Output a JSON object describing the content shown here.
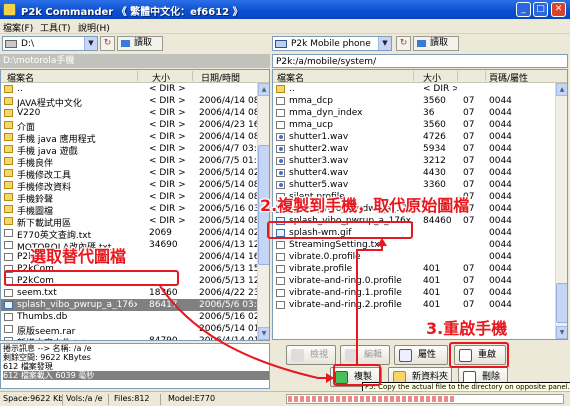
{
  "window": {
    "title": "P2k Commander 《 繁體中文化：ef6612 》",
    "min_label": "_",
    "max_label": "□",
    "close_label": "✕"
  },
  "menu": [
    "檔案(F)",
    "工具(T)",
    "說明(H)"
  ],
  "left_pane": {
    "drive": "D:\\",
    "read_button": "讀取",
    "path": "D:\\motorola手機",
    "columns": [
      "檔案名",
      "大小",
      "日期/時間"
    ],
    "rows": [
      {
        "name": "..",
        "size": "< DIR >",
        "date": "",
        "icon": "folder"
      },
      {
        "name": "JAVA程式中文化",
        "size": "< DIR >",
        "date": "2006/4/14 08:",
        "icon": "folder"
      },
      {
        "name": "V220",
        "size": "< DIR >",
        "date": "2006/4/14 08:",
        "icon": "folder"
      },
      {
        "name": "介面",
        "size": "< DIR >",
        "date": "2006/4/23 16:",
        "icon": "folder"
      },
      {
        "name": "手機 java 應用程式",
        "size": "< DIR >",
        "date": "2006/4/14 08:",
        "icon": "folder"
      },
      {
        "name": "手機 java 遊戲",
        "size": "< DIR >",
        "date": "2006/4/7 03:0",
        "icon": "folder"
      },
      {
        "name": "手機良伴",
        "size": "< DIR >",
        "date": "2006/7/5 01:0",
        "icon": "folder"
      },
      {
        "name": "手機修改工具",
        "size": "< DIR >",
        "date": "2006/5/14 02:",
        "icon": "folder"
      },
      {
        "name": "手機修改資料",
        "size": "< DIR >",
        "date": "2006/5/14 08:",
        "icon": "folder"
      },
      {
        "name": "手機鈴聲",
        "size": "< DIR >",
        "date": "2006/4/14 08:",
        "icon": "folder"
      },
      {
        "name": "手機圖檔",
        "size": "< DIR >",
        "date": "2006/5/16 03:",
        "icon": "folder"
      },
      {
        "name": "新下載試用區",
        "size": "< DIR >",
        "date": "2006/5/14 08:",
        "icon": "folder"
      },
      {
        "name": "E770英文查詢.txt",
        "size": "2069",
        "date": "2006/4/14 02:",
        "icon": "file"
      },
      {
        "name": "MOTOROLA改內碼.txt",
        "size": "34690",
        "date": "2006/4/13 12:",
        "icon": "file"
      },
      {
        "name": "P2k_Ne",
        "size": "",
        "date": "2006/4/14 16:",
        "icon": "file"
      },
      {
        "name": "P2kCom",
        "size": "",
        "date": "2006/5/13 15:",
        "icon": "file"
      },
      {
        "name": "P2kCom",
        "size": "",
        "date": "2006/5/13 12:",
        "icon": "file"
      },
      {
        "name": "seem.txt",
        "size": "18360",
        "date": "2006/4/22 23:",
        "icon": "file"
      },
      {
        "name": "splash_vibo_pwrup_a_176x...",
        "size": "86417",
        "date": "2006/5/6 03:1",
        "icon": "img",
        "selected": true
      },
      {
        "name": "Thumbs.db",
        "size": "",
        "date": "2006/5/16 02:",
        "icon": "file"
      },
      {
        "name": "原版seem.rar",
        "size": "",
        "date": "2006/5/14 01:",
        "icon": "file"
      },
      {
        "name": "新增文字文件.txt",
        "size": "84790",
        "date": "2006/4/14 01:",
        "icon": "file"
      }
    ],
    "info_lines": [
      "捲示訊息 --> 名稱: /a /e",
      "剩餘空間: 9622 KBytes",
      "612 檔案發現",
      "612 檔案載入 6039 毫秒"
    ]
  },
  "right_pane": {
    "drive": "P2k Mobile phone",
    "read_button": "讀取",
    "path": "P2k:/a/mobile/system/",
    "columns": [
      "檔案名",
      "大小",
      "",
      "頁碼/屬性"
    ],
    "rows": [
      {
        "name": "..",
        "size": "< DIR >",
        "c3": "",
        "attr": "",
        "icon": "folder"
      },
      {
        "name": "mma_dcp",
        "size": "3560",
        "c3": "07",
        "attr": "0044",
        "icon": "file"
      },
      {
        "name": "mma_dyn_index",
        "size": "36",
        "c3": "07",
        "attr": "0044",
        "icon": "file"
      },
      {
        "name": "mma_ucp",
        "size": "3560",
        "c3": "07",
        "attr": "0044",
        "icon": "file"
      },
      {
        "name": "shutter1.wav",
        "size": "4726",
        "c3": "07",
        "attr": "0044",
        "icon": "media"
      },
      {
        "name": "shutter2.wav",
        "size": "5934",
        "c3": "07",
        "attr": "0044",
        "icon": "media"
      },
      {
        "name": "shutter3.wav",
        "size": "3212",
        "c3": "07",
        "attr": "0044",
        "icon": "media"
      },
      {
        "name": "shutter4.wav",
        "size": "4430",
        "c3": "07",
        "attr": "0044",
        "icon": "media"
      },
      {
        "name": "shutter5.wav",
        "size": "3360",
        "c3": "07",
        "attr": "0044",
        "icon": "media"
      },
      {
        "name": "silent.profile",
        "size": "",
        "c3": "07",
        "attr": "0044",
        "icon": "file"
      },
      {
        "name": "splash_vibo_pwrdwn_a_176...",
        "size": "",
        "c3": "07",
        "attr": "0044",
        "icon": "img"
      },
      {
        "name": "splash_vibo_pwrup_a_176x...",
        "size": "84460",
        "c3": "07",
        "attr": "0044",
        "icon": "img"
      },
      {
        "name": "splash-wm.gif",
        "size": "",
        "c3": "",
        "attr": "0044",
        "icon": "img"
      },
      {
        "name": "StreamingSetting.txt",
        "size": "",
        "c3": "",
        "attr": "0044",
        "icon": "file"
      },
      {
        "name": "vibrate.0.profile",
        "size": "",
        "c3": "",
        "attr": "0044",
        "icon": "file"
      },
      {
        "name": "vibrate.profile",
        "size": "401",
        "c3": "07",
        "attr": "0044",
        "icon": "file"
      },
      {
        "name": "vibrate-and-ring.0.profile",
        "size": "401",
        "c3": "07",
        "attr": "0044",
        "icon": "file"
      },
      {
        "name": "vibrate-and-ring.1.profile",
        "size": "401",
        "c3": "07",
        "attr": "0044",
        "icon": "file"
      },
      {
        "name": "vibrate-and-ring.2.profile",
        "size": "401",
        "c3": "07",
        "attr": "0044",
        "icon": "file"
      }
    ]
  },
  "actions": {
    "view": "檢視",
    "edit": "編輯",
    "props": "屬性",
    "restart": "重啟",
    "copy": "複製",
    "newfolder": "新資料夾",
    "delete": "刪除"
  },
  "tooltip": "F5: Copy the actual file to the directory on opposite panel.",
  "status": {
    "space": "Space:9622 Kb",
    "vols": "Vols:/a /e",
    "files": "Files:812",
    "model": "Model:E770",
    "progress_fraction": 0.6
  },
  "annotations": {
    "select": "選取替代圖檔",
    "copy": "2.複製到手機，取代原始圖檔",
    "restart": "3.重啟手機"
  },
  "colors": {
    "annotation": "#e8181e",
    "titlebar": "#0a4ed0",
    "selection": "#808080"
  }
}
